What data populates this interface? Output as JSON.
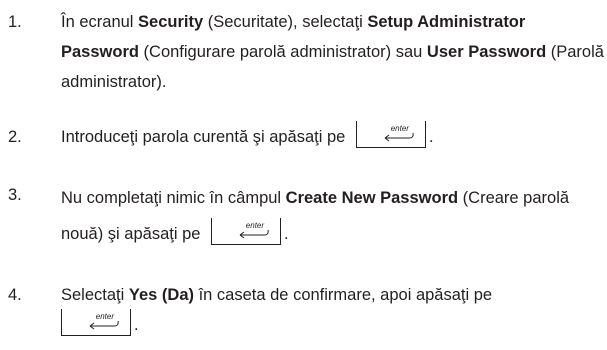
{
  "steps": [
    {
      "number": "1.",
      "parts": [
        "În ecranul ",
        "Security",
        " (Securitate), selectaţi ",
        "Setup Administrator Password",
        " (Configurare parolă administrator) sau ",
        "User Password",
        " (Parolă administrator)."
      ]
    },
    {
      "number": "2.",
      "parts": [
        "Introduceţi parola curentă şi apăsaţi pe"
      ],
      "end": "."
    },
    {
      "number": "3.",
      "parts": [
        "Nu completaţi nimic în câmpul ",
        "Create New Password",
        " (Creare parolă nouă) şi apăsaţi pe"
      ],
      "end": "."
    },
    {
      "number": "4.",
      "parts": [
        "Selectaţi ",
        "Yes (Da)",
        " în caseta de confirmare, apoi apăsaţi pe"
      ],
      "end": "."
    }
  ],
  "key": {
    "label": "enter",
    "icon": "return-arrow-icon"
  }
}
